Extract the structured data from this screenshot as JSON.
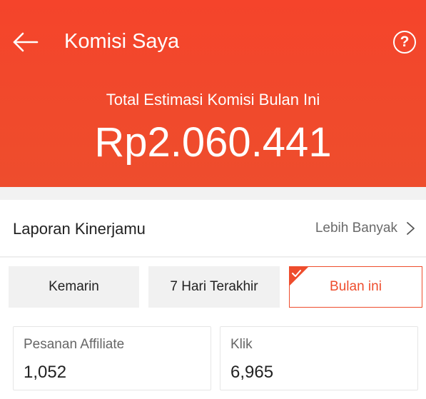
{
  "header": {
    "title": "Komisi Saya",
    "help_icon": "question-circle-icon",
    "help_glyph": "?",
    "back_icon": "arrow-left-icon",
    "subtitle": "Total Estimasi Komisi Bulan Ini",
    "amount": "Rp2.060.441",
    "background_color": "#ee4d2d"
  },
  "report": {
    "title": "Laporan Kinerjamu",
    "more_label": "Lebih Banyak",
    "more_icon": "chevron-right-icon"
  },
  "tabs": [
    {
      "label": "Kemarin",
      "selected": false
    },
    {
      "label": "7 Hari Terakhir",
      "selected": false
    },
    {
      "label": "Bulan ini",
      "selected": true
    }
  ],
  "stats": [
    {
      "label": "Pesanan Affiliate",
      "value": "1,052"
    },
    {
      "label": "Klik",
      "value": "6,965"
    }
  ],
  "accent_color": "#ee4d2d"
}
